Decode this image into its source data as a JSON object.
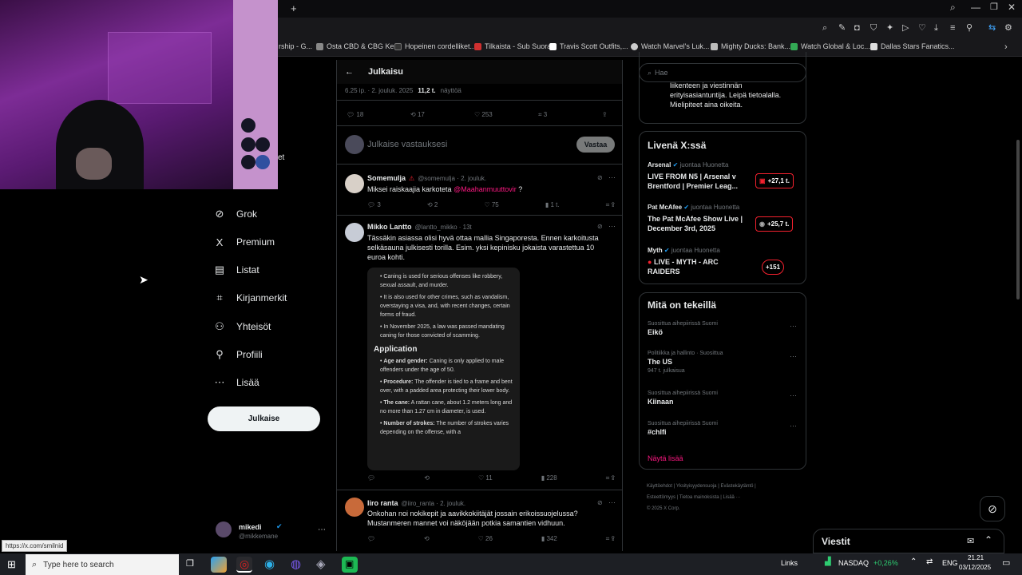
{
  "browser": {
    "bookmarks": [
      "rship - G...",
      "Osta CBD & CBG Ke...",
      "Hopeinen cordelliket...",
      "Tilkaista - Sub Suora",
      "Travis Scott Outfits,...",
      "Watch Marvel's Luk...",
      "Mighty Ducks: Bank...",
      "Watch Global & Loc...",
      "Dallas Stars Fanatics..."
    ],
    "status_url": "https://x.com/smilnid"
  },
  "sidebar": {
    "items": [
      {
        "label": "Grok",
        "icon": "grok-icon",
        "glyph": "⊘"
      },
      {
        "label": "Premium",
        "icon": "x-logo-icon",
        "glyph": "X"
      },
      {
        "label": "Listat",
        "icon": "list-icon",
        "glyph": "▤"
      },
      {
        "label": "Kirjanmerkit",
        "icon": "bookmark-icon",
        "glyph": "⌗"
      },
      {
        "label": "Yhteisöt",
        "icon": "communities-icon",
        "glyph": "⚇"
      },
      {
        "label": "Profiili",
        "icon": "profile-icon",
        "glyph": "⚲"
      },
      {
        "label": "Lisää",
        "icon": "more-icon",
        "glyph": "⋯"
      }
    ],
    "post_button": "Julkaise",
    "partial_label": "et",
    "account": {
      "name": "mikedi",
      "handle": "@mikkemane"
    }
  },
  "main": {
    "title": "Julkaisu",
    "meta": {
      "time": "6.25 ip. · 2. jouluk. 2025",
      "views": "11,2 t.",
      "views_label": "näyttöä"
    },
    "stats": {
      "replies": "18",
      "reposts": "17",
      "likes": "253",
      "bookmarks": "3"
    },
    "reply_placeholder": "Julkaise vastauksesi",
    "reply_button": "Vastaa",
    "tweets": [
      {
        "name": "Somemulja",
        "handle": "@somemulja · 2. jouluk.",
        "text": "Miksei raiskaajia karkoteta",
        "mention": "@Maahanmuuttovir",
        "text_end": " ?",
        "replies": "3",
        "reposts": "2",
        "likes": "75",
        "views": "1 t."
      },
      {
        "name": "Mikko Lantto",
        "handle": "@lantto_mikko · 13t",
        "text": "Tässäkin asiassa olisi hyvä ottaa mallia Singaporesta. Ennen karkoitusta selkäsauna julkisesti torilla. Esim. yksi kepinisku jokaista varastettua 10 euroa kohti.",
        "grok": {
          "bullets": [
            "Caning is used for serious offenses like robbery, sexual assault, and murder.",
            "It is also used for other crimes, such as vandalism, overstaying a visa, and, with recent changes, certain forms of fraud.",
            "In November 2025, a law was passed mandating caning for those convicted of scamming."
          ],
          "heading": "Application",
          "items": [
            {
              "b": "Age and gender:",
              "t": " Caning is only applied to male offenders under the age of 50."
            },
            {
              "b": "Procedure:",
              "t": " The offender is tied to a frame and bent over, with a padded area protecting their lower body."
            },
            {
              "b": "The cane:",
              "t": " A rattan cane, about 1.2 meters long and no more than 1.27 cm in diameter, is used."
            },
            {
              "b": "Number of strokes:",
              "t": " The number of strokes varies depending on the offense, with a"
            }
          ]
        },
        "replies": "",
        "reposts": "",
        "likes": "11",
        "views": "228"
      },
      {
        "name": "Iiro ranta",
        "handle": "@iiro_ranta · 2. jouluk.",
        "text": "Onkohan noi nokikepit ja aavikkokiitäjät jossain erikoissuojelussa? Mustanmeren mannet voi näköjään potkia samantien vidhuun.",
        "replies": "",
        "reposts": "",
        "likes": "26",
        "views": "342"
      }
    ]
  },
  "right": {
    "search_placeholder": "Hae",
    "about_snippet": "liikenteen ja viestinnän erityisasiantuntija. Leipä tietoalalla. Mielipiteet aina oikeita.",
    "live": {
      "title": "Livenä X:ssä",
      "items": [
        {
          "host": "Arsenal",
          "note": "juontaa Huonetta",
          "title": "LIVE FROM N5 | Arsenal v Brentford | Premier Leag...",
          "count": "+27,1 t."
        },
        {
          "host": "Pat McAfee",
          "note": "juontaa Huonetta",
          "title": "The Pat McAfee Show Live | December 3rd, 2025",
          "count": "+25,7 t."
        },
        {
          "host": "Myth",
          "note": "juontaa Huonetta",
          "title": "LIVE - MYTH - ARC RAIDERS",
          "count": "+151"
        }
      ]
    },
    "trends": {
      "title": "Mitä on tekeillä",
      "items": [
        {
          "context": "Suosittua aihepiirissä Suomi",
          "name": "Eikö",
          "posts": ""
        },
        {
          "context": "Politiikka ja hallinto · Suosittua",
          "name": "The US",
          "posts": "947 t. julkaisua"
        },
        {
          "context": "Suosittua aihepiirissä Suomi",
          "name": "Kiinaan",
          "posts": ""
        },
        {
          "context": "Suosittua aihepiirissä Suomi",
          "name": "#chlfi",
          "posts": ""
        }
      ],
      "show_more": "Näytä lisää"
    },
    "footer": [
      "Käyttöehdot",
      "Yksityisyydensuoja",
      "Evästekäytäntö",
      "Esteettömyys",
      "Tietoa mainoksista",
      "Lisää ···",
      "© 2025 X Corp."
    ]
  },
  "messages": {
    "title": "Viestit"
  },
  "taskbar": {
    "search_placeholder": "Type here to search",
    "links": "Links",
    "ticker": "NASDAQ",
    "change": "+0,26%",
    "lang": "ENG",
    "time": "21.21",
    "date": "03/12/2025"
  },
  "colors": {
    "accent": "#1d9bf0",
    "live_red": "#f4212e",
    "mention": "#f91880",
    "up": "#2ecc71"
  }
}
